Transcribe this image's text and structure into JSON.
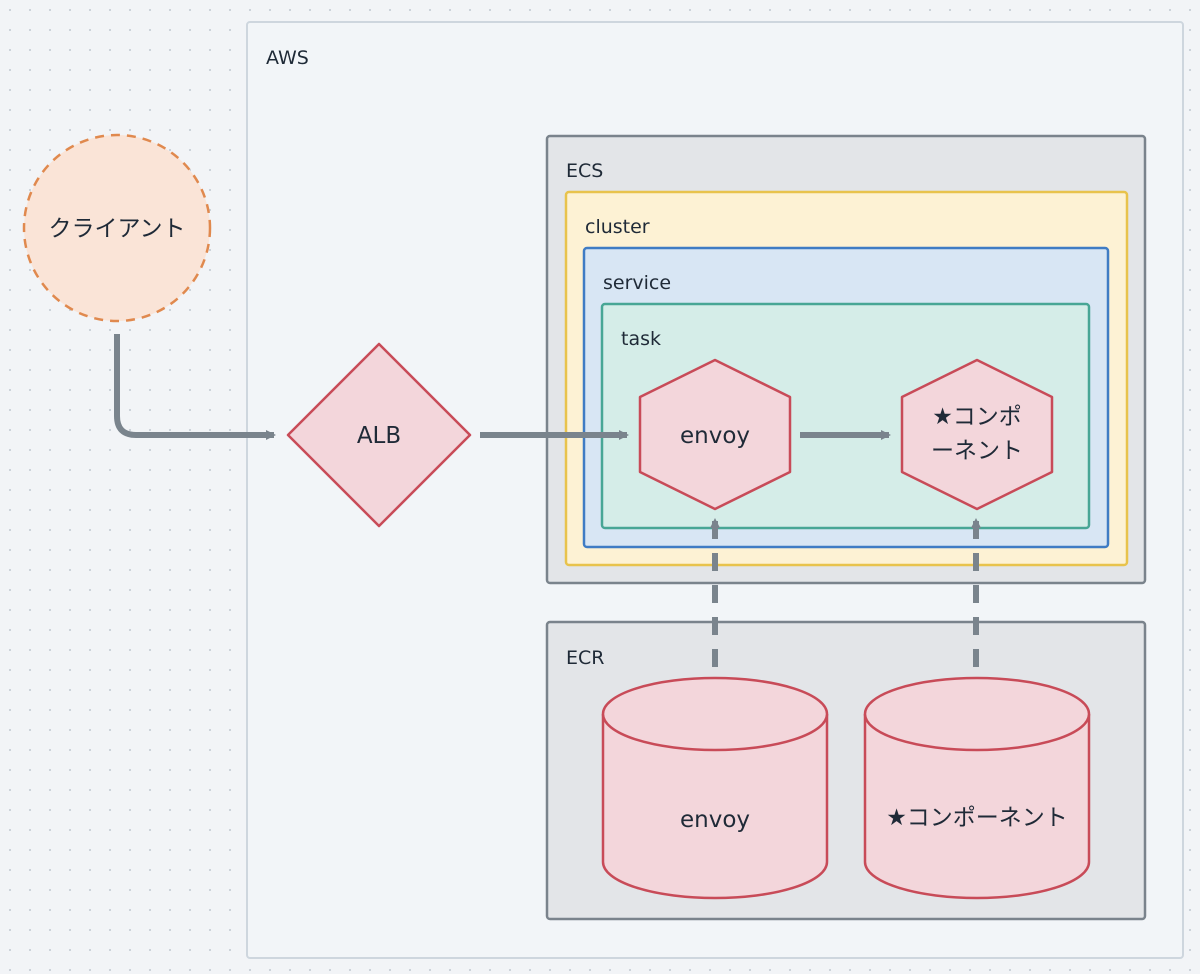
{
  "colors": {
    "canvas": "#f2f4f7",
    "aws_fill": "#f2f5f8",
    "aws_stroke": "#ced6de",
    "ecs_fill": "#e3e5e8",
    "ecs_stroke": "#7a838c",
    "cluster_fill": "#fdf2d4",
    "cluster_stroke": "#e8c34c",
    "service_fill": "#d8e6f4",
    "service_stroke": "#3f7cc4",
    "task_fill": "#d5ede8",
    "task_stroke": "#48a695",
    "node_fill": "#f3d6db",
    "node_stroke": "#c84b58",
    "client_fill": "#fae4d7",
    "client_stroke": "#e0894e",
    "edge": "#7a848d",
    "text": "#1f2a37"
  },
  "groups": {
    "aws": "AWS",
    "ecs": "ECS",
    "cluster": "cluster",
    "service": "service",
    "task": "task",
    "ecr": "ECR"
  },
  "nodes": {
    "client": {
      "label": "クライアント",
      "shape": "circle",
      "style": "dashed"
    },
    "alb": {
      "label": "ALB",
      "shape": "diamond"
    },
    "envoy_container": {
      "label": "envoy",
      "shape": "hexagon"
    },
    "component_container": {
      "label_lines": [
        "★コンポ",
        "ーネント"
      ],
      "shape": "hexagon"
    },
    "envoy_image": {
      "label": "envoy",
      "shape": "cylinder"
    },
    "component_image": {
      "label": "★コンポーネント",
      "shape": "cylinder"
    }
  },
  "edges": [
    {
      "from": "client",
      "to": "alb",
      "style": "solid"
    },
    {
      "from": "alb",
      "to": "envoy_container",
      "style": "solid"
    },
    {
      "from": "envoy_container",
      "to": "component_container",
      "style": "solid"
    },
    {
      "from": "envoy_image",
      "to": "envoy_container",
      "style": "dashed"
    },
    {
      "from": "component_image",
      "to": "component_container",
      "style": "dashed"
    }
  ]
}
